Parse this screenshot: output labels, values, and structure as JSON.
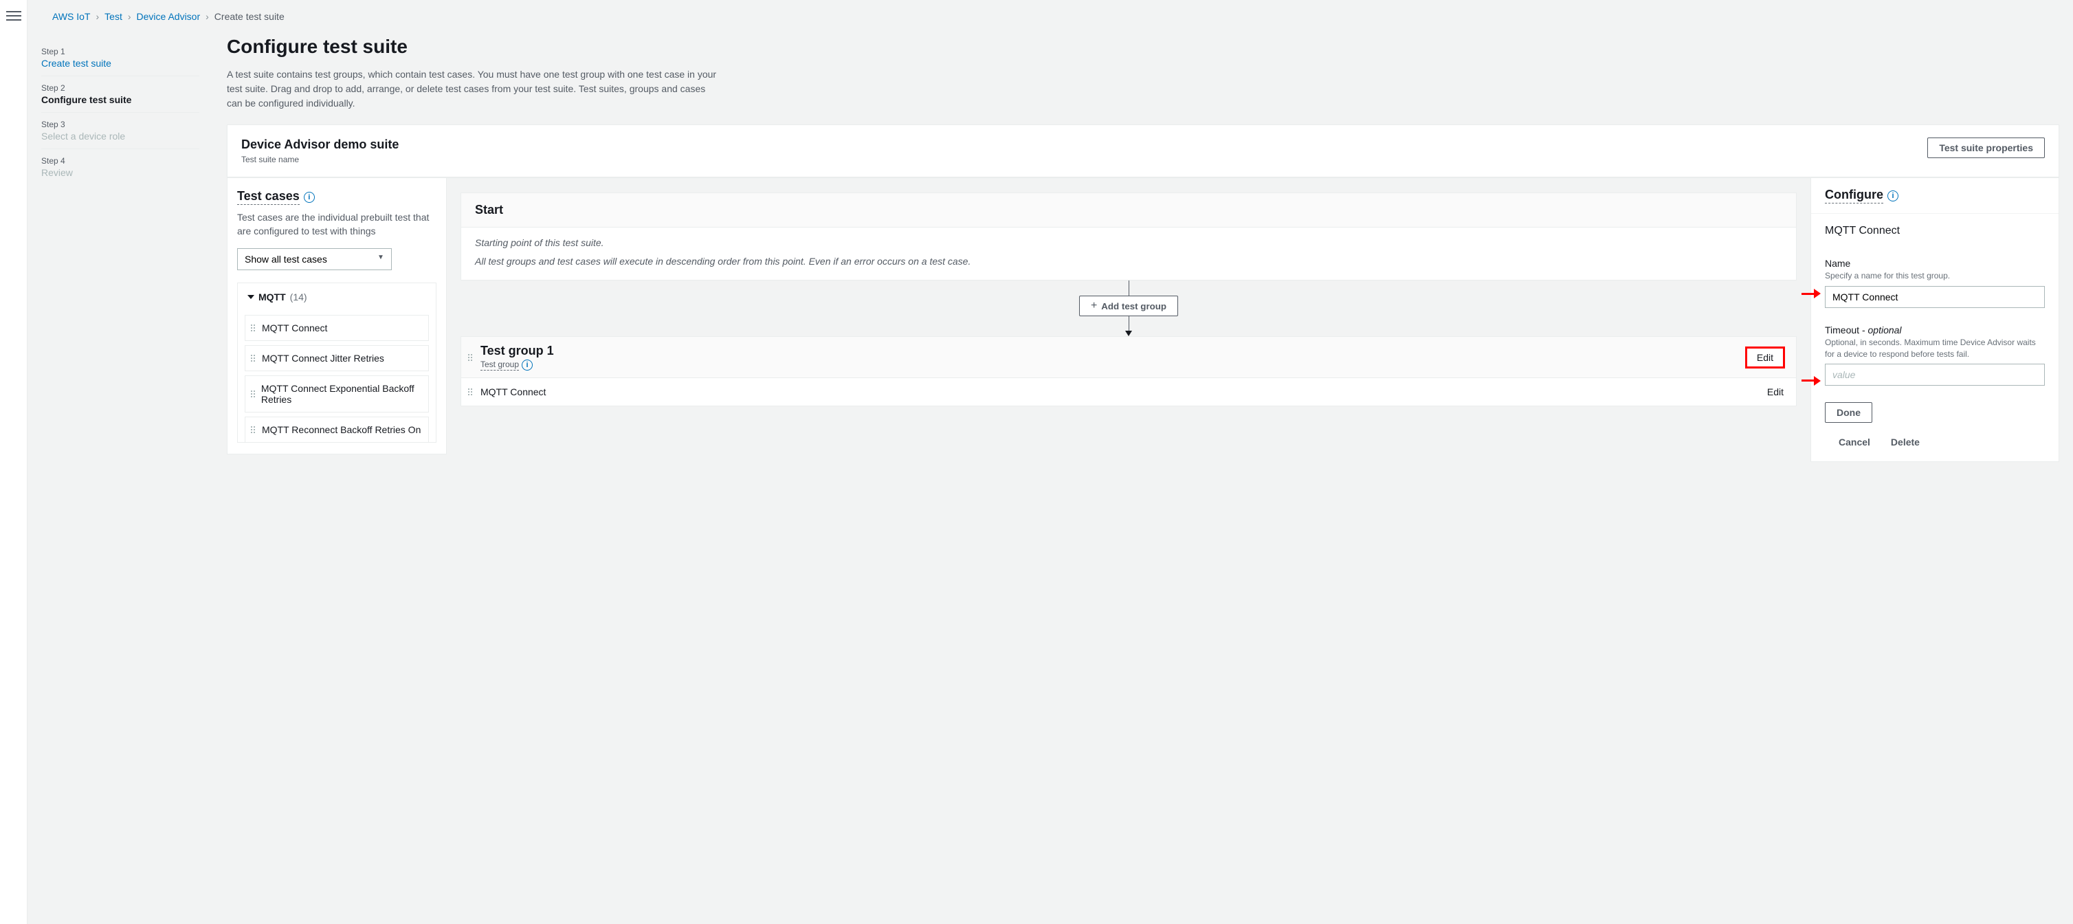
{
  "breadcrumbs": {
    "items": [
      "AWS IoT",
      "Test",
      "Device Advisor"
    ],
    "current": "Create test suite"
  },
  "wizard": {
    "step1_num": "Step 1",
    "step1_title": "Create test suite",
    "step2_num": "Step 2",
    "step2_title": "Configure test suite",
    "step3_num": "Step 3",
    "step3_title": "Select a device role",
    "step4_num": "Step 4",
    "step4_title": "Review"
  },
  "page": {
    "title": "Configure test suite",
    "description": "A test suite contains test groups, which contain test cases. You must have one test group with one test case in your test suite. Drag and drop to add, arrange, or delete test cases from your test suite. Test suites, groups and cases can be configured individually."
  },
  "suite": {
    "name": "Device Advisor demo suite",
    "sub": "Test suite name",
    "properties_btn": "Test suite properties"
  },
  "test_cases": {
    "heading": "Test cases",
    "desc": "Test cases are the individual prebuilt test that are configured to test with things",
    "filter_selected": "Show all test cases",
    "category": "MQTT",
    "category_count": "(14)",
    "items": [
      "MQTT Connect",
      "MQTT Connect Jitter Retries",
      "MQTT Connect Exponential Backoff Retries",
      "MQTT Reconnect Backoff Retries On"
    ]
  },
  "flow": {
    "start_title": "Start",
    "start_line1": "Starting point of this test suite.",
    "start_line2": "All test groups and test cases will execute in descending order from this point. Even if an error occurs on a test case.",
    "add_group_btn": "Add test group",
    "group": {
      "title": "Test group 1",
      "sub": "Test group",
      "edit_btn": "Edit",
      "items": [
        {
          "name": "MQTT Connect",
          "edit": "Edit"
        }
      ]
    }
  },
  "configure": {
    "heading": "Configure",
    "subject": "MQTT Connect",
    "name_label": "Name",
    "name_hint": "Specify a name for this test group.",
    "name_value": "MQTT Connect",
    "timeout_label": "Timeout - ",
    "timeout_optional": "optional",
    "timeout_hint": "Optional, in seconds. Maximum time Device Advisor waits for a device to respond before tests fail.",
    "timeout_placeholder": "value",
    "done_btn": "Done",
    "cancel_btn": "Cancel",
    "delete_btn": "Delete"
  }
}
